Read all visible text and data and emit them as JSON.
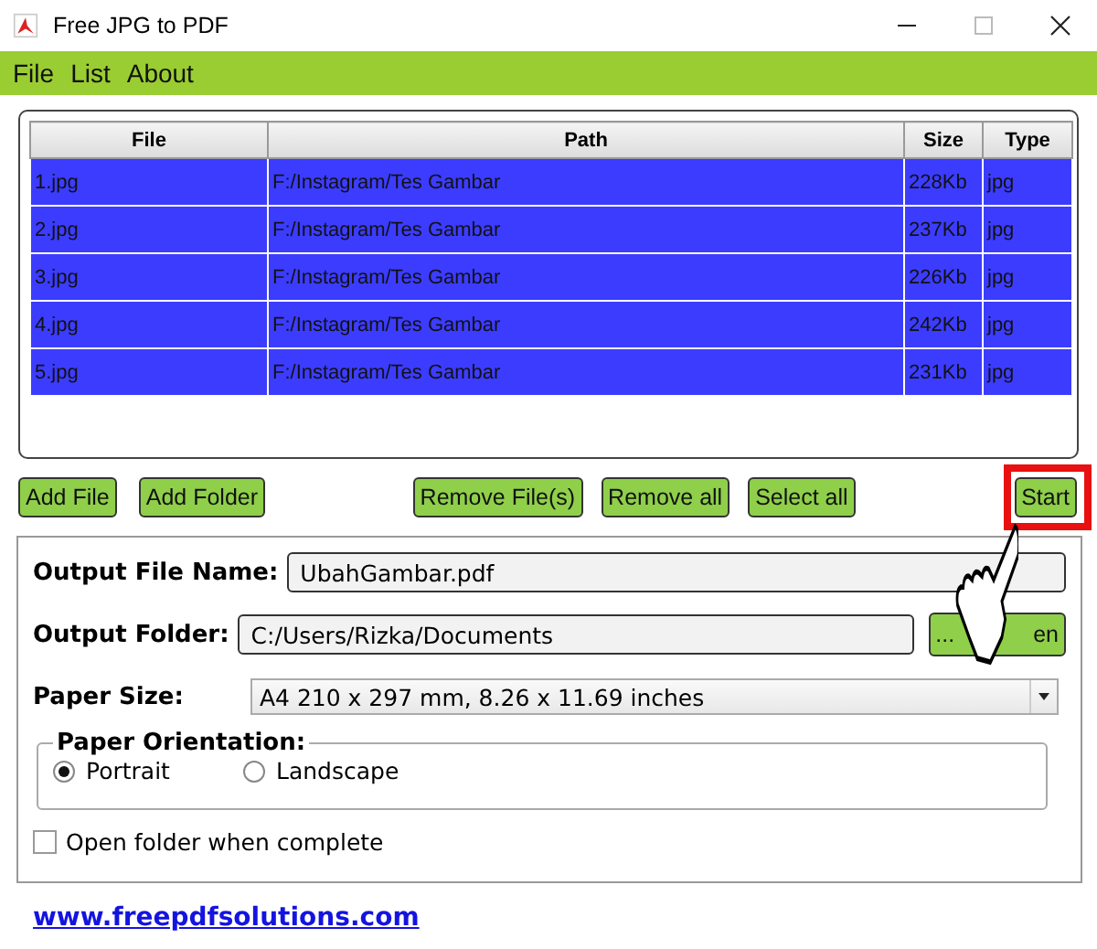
{
  "window": {
    "title": "Free JPG to PDF"
  },
  "menu": [
    "File",
    "List",
    "About"
  ],
  "table": {
    "columns": [
      "File",
      "Path",
      "Size",
      "Type"
    ],
    "rows": [
      {
        "cells": [
          "1.jpg",
          "F:/Instagram/Tes Gambar",
          "228Kb",
          "jpg"
        ],
        "selected": true
      },
      {
        "cells": [
          "2.jpg",
          "F:/Instagram/Tes Gambar",
          "237Kb",
          "jpg"
        ],
        "selected": true
      },
      {
        "cells": [
          "3.jpg",
          "F:/Instagram/Tes Gambar",
          "226Kb",
          "jpg"
        ],
        "selected": true
      },
      {
        "cells": [
          "4.jpg",
          "F:/Instagram/Tes Gambar",
          "242Kb",
          "jpg"
        ],
        "selected": true
      },
      {
        "cells": [
          "5.jpg",
          "F:/Instagram/Tes Gambar",
          "231Kb",
          "jpg"
        ],
        "selected": true
      }
    ]
  },
  "buttons_left": [
    "Add File",
    "Add Folder"
  ],
  "buttons_mid": [
    "Remove File(s)",
    "Remove all",
    "Select all"
  ],
  "start_button": "Start",
  "output_file_name": {
    "label": "Output File Name:",
    "value": "UbahGambar.pdf"
  },
  "output_folder": {
    "label": "Output Folder:",
    "value": "C:/Users/Rizka/Documents",
    "button_parts": [
      "...",
      "en"
    ]
  },
  "paper_size": {
    "label": "Paper Size:",
    "value": "A4 210 x 297 mm, 8.26 x 11.69 inches"
  },
  "orientation": {
    "label": "Paper Orientation:",
    "options": [
      {
        "label": "Portrait",
        "selected": true
      },
      {
        "label": "Landscape",
        "selected": false
      }
    ]
  },
  "open_folder": {
    "label": "Open folder when complete",
    "checked": false
  },
  "link": "www.freepdfsolutions.com"
}
